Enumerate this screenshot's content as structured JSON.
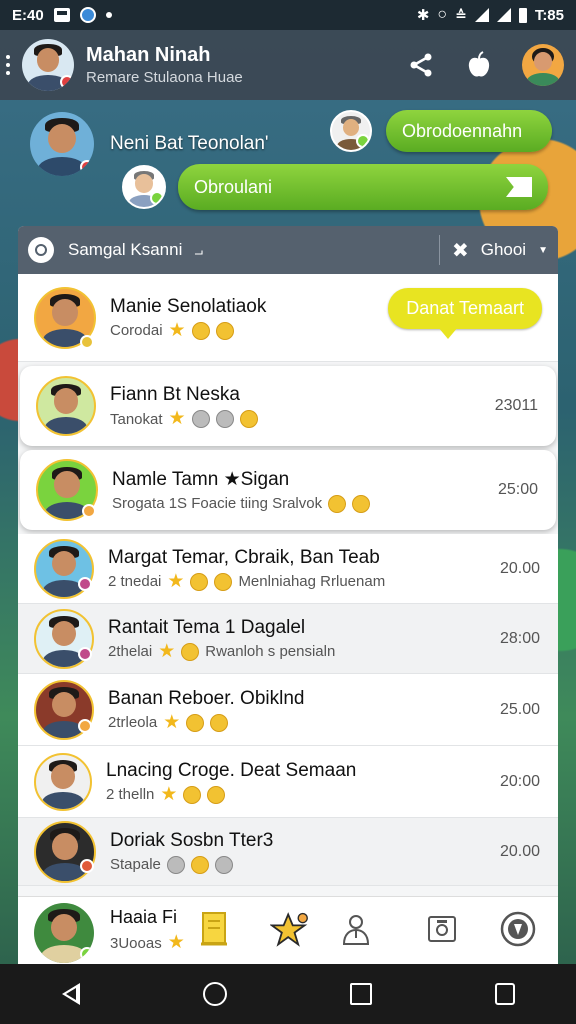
{
  "status_bar": {
    "time": "E:40",
    "right_time": "T:85",
    "icons": [
      "photo-icon",
      "app-icon",
      "dot-icon",
      "bluetooth-icon",
      "alarm-icon",
      "wifi-icon",
      "signal-icon",
      "signal-icon",
      "battery-icon"
    ]
  },
  "header": {
    "title": "Mahan Ninah",
    "subtitle": "Remare Stulaona Huae",
    "actions": [
      "share-icon",
      "apple-icon",
      "profile-avatar"
    ]
  },
  "chat_preview": {
    "heading": "Neni Bat Teonolan'",
    "top_pill": "Obrodoennahn",
    "main_pill": "Obroulani"
  },
  "search": {
    "text": "Samgal Ksanni",
    "right_label": "Ghooi"
  },
  "items": [
    {
      "name": "Manie Senolatiaok",
      "sub": "Corodai",
      "time": "",
      "bubble": "Danat Temaart",
      "avatar_bg": "#f2a742",
      "badge": "#e8c23a",
      "emoji": [
        "star",
        "face",
        "face"
      ]
    },
    {
      "name": "Fiann Bt Neska",
      "sub": "Tanokat",
      "time": "23011",
      "avatar_bg": "#cfe8a0",
      "badge": "",
      "emoji": [
        "star",
        "gray",
        "gray",
        "face"
      ]
    },
    {
      "name": "Namle Tamn ★Sigan",
      "sub": "Srogata 1S Foacie tiing Sralvok",
      "time": "25:00",
      "avatar_bg": "#7ad33e",
      "badge": "#f2a742",
      "emoji": [
        "face",
        "face"
      ]
    },
    {
      "name": "Margat Temar, Cbraik, Ban Teab",
      "sub": "2 tnedai",
      "sub2": "Menlniahag Rrluenam",
      "time": "20.00",
      "avatar_bg": "#6ec1e4",
      "badge": "#c04a8a",
      "emoji": [
        "star",
        "face",
        "face"
      ]
    },
    {
      "name": "Rantait Tema 1 Dagalel",
      "sub": "2thelai",
      "sub2": "Rwanloh s pensialn",
      "time": "28:00",
      "avatar_bg": "#dff0f5",
      "badge": "#c04a8a",
      "emoji": [
        "star",
        "face"
      ]
    },
    {
      "name": "Banan Reboer. Obiklnd",
      "sub": "2trleola",
      "time": "25.00",
      "avatar_bg": "#8a3a2a",
      "badge": "#f2a742",
      "emoji": [
        "star",
        "face",
        "face"
      ]
    },
    {
      "name": "Lnacing Croge. Deat Semaan",
      "sub": "2 thelln",
      "time": "20:00",
      "avatar_bg": "#f0f0f0",
      "badge": "",
      "emoji": [
        "star",
        "face",
        "face"
      ]
    },
    {
      "name": "Doriak Sosbn Tter3",
      "sub": "Stapale",
      "time": "20.00",
      "avatar_bg": "#2c2c2c",
      "badge": "#e05a3a",
      "emoji": [
        "gray",
        "face",
        "gray"
      ]
    },
    {
      "name": "Haaia Fi",
      "sub": "3Uooas",
      "time": "",
      "avatar_bg": "#3f8a3e",
      "badge": "#7ad33e",
      "emoji": [
        "star"
      ]
    }
  ],
  "tabbar": {
    "tabs": [
      "list-icon",
      "star-icon",
      "contacts-icon",
      "camera-icon",
      "app-icon"
    ]
  },
  "navbar": {
    "buttons": [
      "back-icon",
      "home-icon",
      "recents-icon",
      "edit-icon"
    ]
  },
  "colors": {
    "accent_green": "#7ac93a",
    "bubble_yellow": "#e8e421",
    "header_gray": "#3c4652"
  }
}
